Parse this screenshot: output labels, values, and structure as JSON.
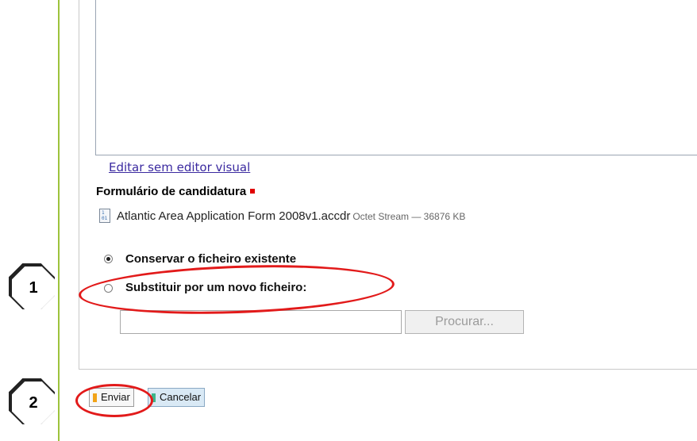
{
  "editor": {
    "edit_link": "Editar sem editor visual"
  },
  "file_field": {
    "label": "Formulário de candidatura",
    "file_name": "Atlantic Area Application Form 2008v1.accdr",
    "file_meta": "Octet Stream — 36876 KB",
    "options": [
      {
        "label": "Conservar o ficheiro existente",
        "checked": true
      },
      {
        "label": "Substituir por um novo ficheiro:",
        "checked": false
      }
    ],
    "input_value": "",
    "browse_label": "Procurar..."
  },
  "actions": {
    "send_label": "Enviar",
    "cancel_label": "Cancelar"
  },
  "annotations": {
    "step1": "1",
    "step2": "2",
    "highlight_color": "#e21a1a"
  },
  "colors": {
    "accent_rule": "#9dc33d",
    "required": "#e00000"
  }
}
